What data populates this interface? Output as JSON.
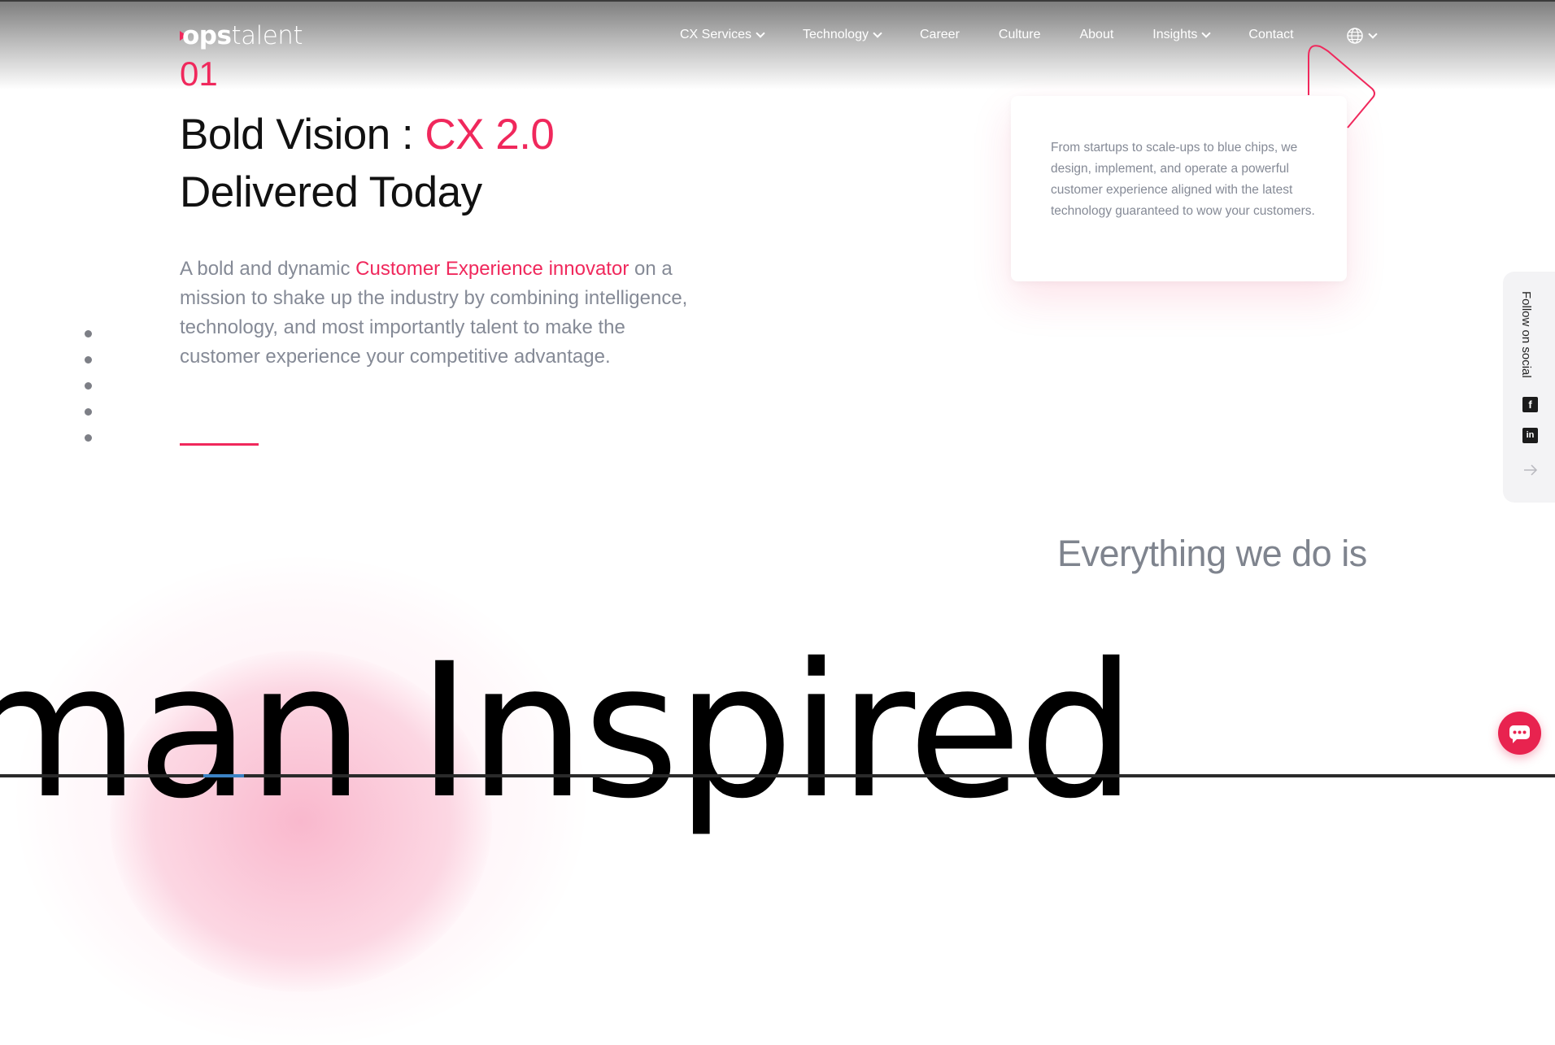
{
  "header": {
    "logo": {
      "prefix": "ops",
      "suffix": "talent"
    },
    "nav": [
      {
        "label": "CX Services",
        "has_dropdown": true
      },
      {
        "label": "Technology",
        "has_dropdown": true
      },
      {
        "label": "Career",
        "has_dropdown": false
      },
      {
        "label": "Culture",
        "has_dropdown": false
      },
      {
        "label": "About",
        "has_dropdown": false
      },
      {
        "label": "Insights",
        "has_dropdown": true
      },
      {
        "label": "Contact",
        "has_dropdown": false
      }
    ],
    "language_icon": "globe-icon"
  },
  "hero": {
    "counter": "01",
    "headline_part1": "Bold Vision : ",
    "headline_accent": "CX 2.0",
    "headline_line2": "Delivered Today",
    "intro_before": "A bold and dynamic ",
    "intro_accent": "Customer Experience innovator",
    "intro_after": " on a mission to shake up the industry by combining intelligence, technology, and most importantly talent to make the customer experience your competitive advantage."
  },
  "slider_dots_count": 5,
  "card": {
    "text": "From startups to scale-ups to blue chips, we design, implement, and operate a powerful customer experience aligned with the latest technology guaranteed to wow your customers."
  },
  "social": {
    "label": "Follow on social",
    "icons": [
      "facebook-icon",
      "linkedin-icon"
    ]
  },
  "section2": {
    "heading": "Everything we do is",
    "big_text": "man Inspired"
  },
  "colors": {
    "accent": "#f0285c",
    "text_gray": "#858a96",
    "dark": "#111111"
  }
}
